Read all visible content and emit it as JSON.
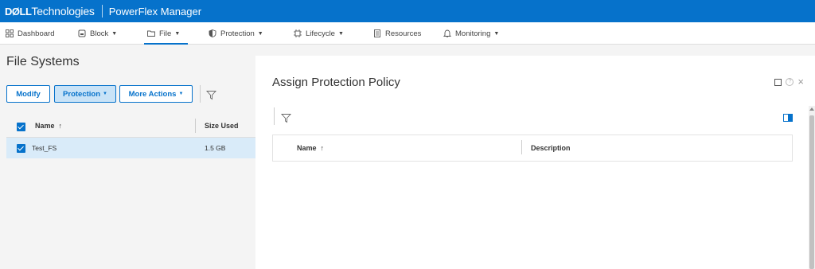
{
  "header": {
    "brand_dell": "DØLL",
    "brand_tech": "Technologies",
    "product": "PowerFlex Manager"
  },
  "nav": {
    "items": [
      {
        "label": "Dashboard",
        "icon": "dashboard-grid-icon",
        "has_caret": false
      },
      {
        "label": "Block",
        "icon": "block-storage-icon",
        "has_caret": true
      },
      {
        "label": "File",
        "icon": "folder-icon",
        "has_caret": true,
        "active": true
      },
      {
        "label": "Protection",
        "icon": "shield-icon",
        "has_caret": true
      },
      {
        "label": "Lifecycle",
        "icon": "lifecycle-icon",
        "has_caret": true
      },
      {
        "label": "Resources",
        "icon": "resources-icon",
        "has_caret": false
      },
      {
        "label": "Monitoring",
        "icon": "bell-icon",
        "has_caret": true
      }
    ]
  },
  "file_systems": {
    "title": "File Systems",
    "buttons": {
      "modify": "Modify",
      "protection": "Protection",
      "more_actions": "More Actions"
    },
    "columns": {
      "name": "Name",
      "sort_arrow": "↑",
      "size_used": "Size Used"
    },
    "rows": [
      {
        "name": "Test_FS",
        "size_used": "1.5 GB",
        "selected": true
      }
    ]
  },
  "dialog": {
    "title": "Assign Protection Policy",
    "columns": {
      "name": "Name",
      "sort_arrow": "↑",
      "description": "Description"
    }
  },
  "colors": {
    "accent": "#0672cb",
    "selected_row": "#d9ebf9",
    "pressed_button": "#c9e3f7"
  }
}
